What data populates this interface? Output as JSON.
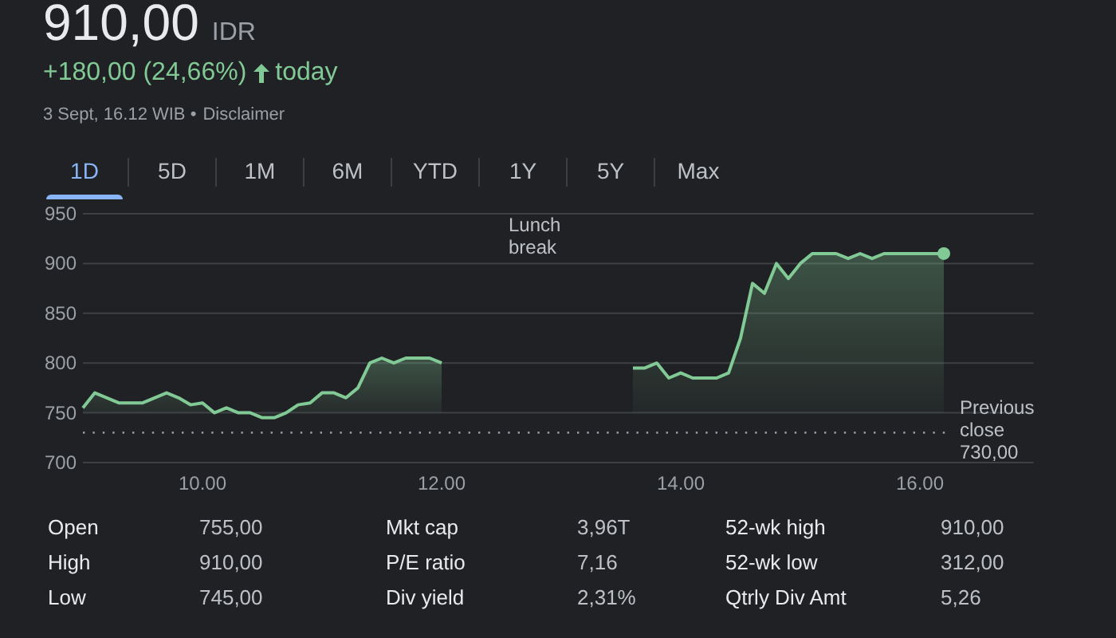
{
  "quote": {
    "price": "910,00",
    "currency": "IDR",
    "change": "+180,00 (24,66%)",
    "period": "today",
    "timestamp": "3 Sept, 16.12 WIB •",
    "disclaimer_link": "Disclaimer"
  },
  "tabs": [
    {
      "label": "1D",
      "selected": true
    },
    {
      "label": "5D",
      "selected": false
    },
    {
      "label": "1M",
      "selected": false
    },
    {
      "label": "6M",
      "selected": false
    },
    {
      "label": "YTD",
      "selected": false
    },
    {
      "label": "1Y",
      "selected": false
    },
    {
      "label": "5Y",
      "selected": false
    },
    {
      "label": "Max",
      "selected": false
    }
  ],
  "chart": {
    "chart_data": {
      "type": "area",
      "xlim": [
        9,
        16.95
      ],
      "ylim": [
        700,
        950
      ],
      "x": [
        9.0,
        9.1,
        9.2,
        9.3,
        9.4,
        9.5,
        9.6,
        9.7,
        9.8,
        9.9,
        10.0,
        10.1,
        10.2,
        10.3,
        10.4,
        10.5,
        10.6,
        10.7,
        10.8,
        10.9,
        11.0,
        11.1,
        11.2,
        11.3,
        11.4,
        11.5,
        11.6,
        11.7,
        11.8,
        11.9,
        12.0,
        13.6,
        13.7,
        13.8,
        13.9,
        14.0,
        14.1,
        14.2,
        14.3,
        14.4,
        14.5,
        14.6,
        14.7,
        14.8,
        14.9,
        15.0,
        15.1,
        15.2,
        15.3,
        15.4,
        15.5,
        15.6,
        15.7,
        15.8,
        15.9,
        16.0,
        16.1,
        16.2
      ],
      "series": [
        {
          "color": "#81c995",
          "values": [
            755,
            770,
            765,
            760,
            760,
            760,
            765,
            770,
            765,
            758,
            760,
            750,
            755,
            750,
            750,
            745,
            745,
            750,
            758,
            760,
            770,
            770,
            765,
            775,
            800,
            805,
            800,
            805,
            805,
            805,
            800,
            795,
            795,
            800,
            785,
            790,
            785,
            785,
            785,
            790,
            825,
            880,
            870,
            900,
            885,
            900,
            910,
            910,
            910,
            905,
            910,
            905,
            910,
            910,
            910,
            910,
            910,
            910
          ]
        }
      ],
      "xticks": [
        {
          "value": 10,
          "label": "10.00"
        },
        {
          "value": 12,
          "label": "12.00"
        },
        {
          "value": 14,
          "label": "14.00"
        },
        {
          "value": 16,
          "label": "16.00"
        }
      ],
      "yticks": [
        700,
        750,
        800,
        850,
        900,
        950
      ],
      "grid": true,
      "annotations": [
        {
          "text": "Lunch break"
        }
      ],
      "ref_lines": [
        {
          "axis": "y",
          "value": 730,
          "label": "Previous close 730,00"
        }
      ]
    }
  },
  "stats": [
    [
      {
        "label": "Open",
        "value": "755,00"
      },
      {
        "label": "Mkt cap",
        "value": "3,96T"
      },
      {
        "label": "52-wk high",
        "value": "910,00"
      }
    ],
    [
      {
        "label": "High",
        "value": "910,00"
      },
      {
        "label": "P/E ratio",
        "value": "7,16"
      },
      {
        "label": "52-wk low",
        "value": "312,00"
      }
    ],
    [
      {
        "label": "Low",
        "value": "745,00"
      },
      {
        "label": "Div yield",
        "value": "2,31%"
      },
      {
        "label": "Qtrly Div Amt",
        "value": "5,26"
      }
    ]
  ]
}
